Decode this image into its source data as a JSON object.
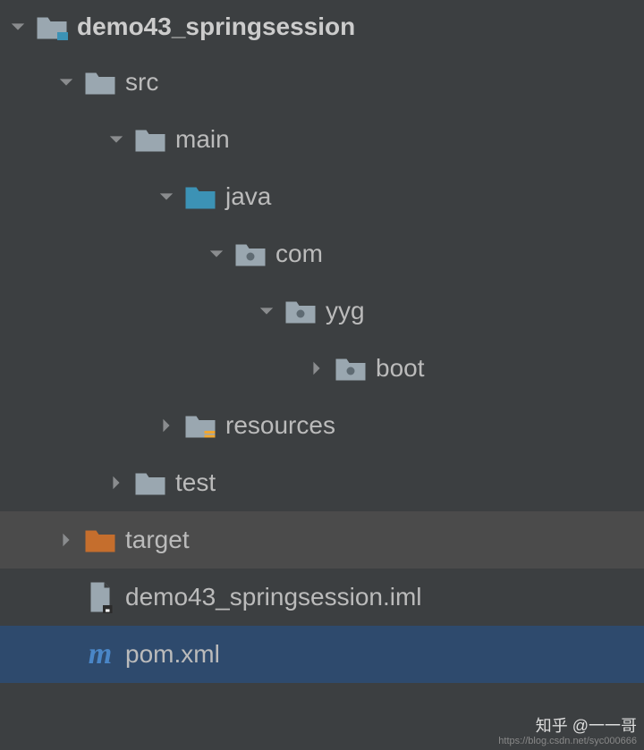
{
  "tree": {
    "root": {
      "label": "demo43_springsession"
    },
    "src": {
      "label": "src"
    },
    "main": {
      "label": "main"
    },
    "java": {
      "label": "java"
    },
    "com": {
      "label": "com"
    },
    "yyg": {
      "label": "yyg"
    },
    "boot": {
      "label": "boot"
    },
    "resources": {
      "label": "resources"
    },
    "test": {
      "label": "test"
    },
    "target": {
      "label": "target"
    },
    "iml": {
      "label": "demo43_springsession.iml"
    },
    "pom": {
      "label": "pom.xml"
    }
  },
  "watermark": {
    "zhihu": "知乎 @一一哥",
    "csdn": "https://blog.csdn.net/syc000666"
  }
}
